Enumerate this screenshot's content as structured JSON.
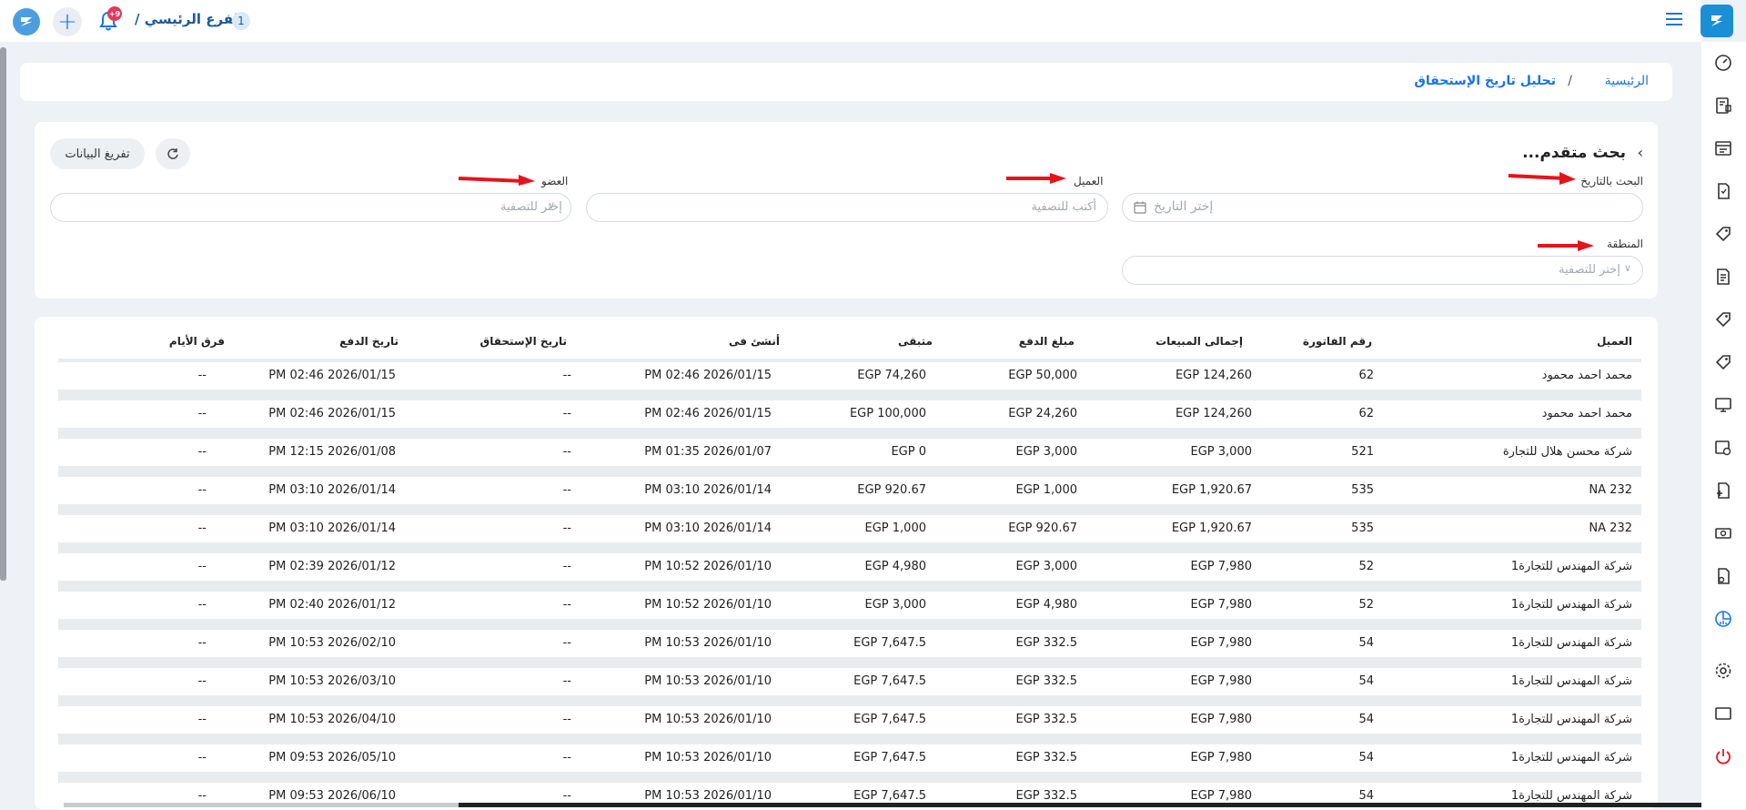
{
  "header": {
    "branch_name": "الفرع الرئيسي /",
    "branch_number": "1",
    "notification_count": "+9"
  },
  "breadcrumb": {
    "home": "الرئيسية",
    "separator": "/",
    "current": "تحليل تاريخ الإستحقاق"
  },
  "filters": {
    "title": "بحث متقدم...",
    "date_label": "البحث بالتاريخ",
    "date_placeholder": "إختر التاريخ",
    "client_label": "العميل",
    "client_placeholder": "أكتب للتصفية",
    "member_label": "العضو",
    "member_placeholder": "إختر للتصفية",
    "region_label": "المنطقة",
    "region_placeholder": "إختر للتصفية",
    "clear_label": "تفريغ البيانات"
  },
  "table": {
    "columns": [
      "العميل",
      "رقم الفاتورة",
      "إجمالى المبيعات",
      "مبلغ الدفع",
      "متبقى",
      "أنشئ فى",
      "تاريخ الإستحقاق",
      "تاريخ الدفع",
      "فرق الأيام"
    ],
    "rows": [
      [
        "محمد احمد محمود",
        "62",
        "EGP 124,260",
        "EGP 50,000",
        "EGP 74,260",
        "PM 02:46 2026/01/15",
        "--",
        "PM 02:46 2026/01/15",
        "--"
      ],
      [
        "محمد احمد محمود",
        "62",
        "EGP 124,260",
        "EGP 24,260",
        "EGP 100,000",
        "PM 02:46 2026/01/15",
        "--",
        "PM 02:46 2026/01/15",
        "--"
      ],
      [
        "شركة محسن هلال للتجارة",
        "521",
        "EGP 3,000",
        "EGP 3,000",
        "EGP 0",
        "PM 01:35 2026/01/07",
        "--",
        "PM 12:15 2026/01/08",
        "--"
      ],
      [
        "NA 232",
        "535",
        "EGP 1,920.67",
        "EGP 1,000",
        "EGP 920.67",
        "PM 03:10 2026/01/14",
        "--",
        "PM 03:10 2026/01/14",
        "--"
      ],
      [
        "NA 232",
        "535",
        "EGP 1,920.67",
        "EGP 920.67",
        "EGP 1,000",
        "PM 03:10 2026/01/14",
        "--",
        "PM 03:10 2026/01/14",
        "--"
      ],
      [
        "شركة المهندس للتجارة1",
        "52",
        "EGP 7,980",
        "EGP 3,000",
        "EGP 4,980",
        "PM 10:52 2026/01/10",
        "--",
        "PM 02:39 2026/01/12",
        "--"
      ],
      [
        "شركة المهندس للتجارة1",
        "52",
        "EGP 7,980",
        "EGP 4,980",
        "EGP 3,000",
        "PM 10:52 2026/01/10",
        "--",
        "PM 02:40 2026/01/12",
        "--"
      ],
      [
        "شركة المهندس للتجارة1",
        "54",
        "EGP 7,980",
        "EGP 332.5",
        "EGP 7,647.5",
        "PM 10:53 2026/01/10",
        "--",
        "PM 10:53 2026/02/10",
        "--"
      ],
      [
        "شركة المهندس للتجارة1",
        "54",
        "EGP 7,980",
        "EGP 332.5",
        "EGP 7,647.5",
        "PM 10:53 2026/01/10",
        "--",
        "PM 10:53 2026/03/10",
        "--"
      ],
      [
        "شركة المهندس للتجارة1",
        "54",
        "EGP 7,980",
        "EGP 332.5",
        "EGP 7,647.5",
        "PM 10:53 2026/01/10",
        "--",
        "PM 10:53 2026/04/10",
        "--"
      ],
      [
        "شركة المهندس للتجارة1",
        "54",
        "EGP 7,980",
        "EGP 332.5",
        "EGP 7,647.5",
        "PM 10:53 2026/01/10",
        "--",
        "PM 09:53 2026/05/10",
        "--"
      ],
      [
        "شركة المهندس للتجارة1",
        "54",
        "EGP 7,980",
        "EGP 332.5",
        "EGP 7,647.5",
        "PM 10:53 2026/01/10",
        "--",
        "PM 09:53 2026/06/10",
        "--"
      ]
    ]
  },
  "colors": {
    "accent": "#1a73e8",
    "brand": "#1a8fd6",
    "arrow": "#e5141b"
  },
  "sidebar_icons": [
    "speedometer-icon",
    "pos-terminal-icon",
    "register-icon",
    "invoice-icon",
    "tag-icon",
    "document-icon",
    "tag-icon-2",
    "tag-icon-3",
    "monitor-icon",
    "image-settings-icon",
    "document-add-icon",
    "money-icon",
    "user-doc-icon",
    "report-chart-icon",
    "settings-icon",
    "window-icon",
    "power-icon"
  ]
}
